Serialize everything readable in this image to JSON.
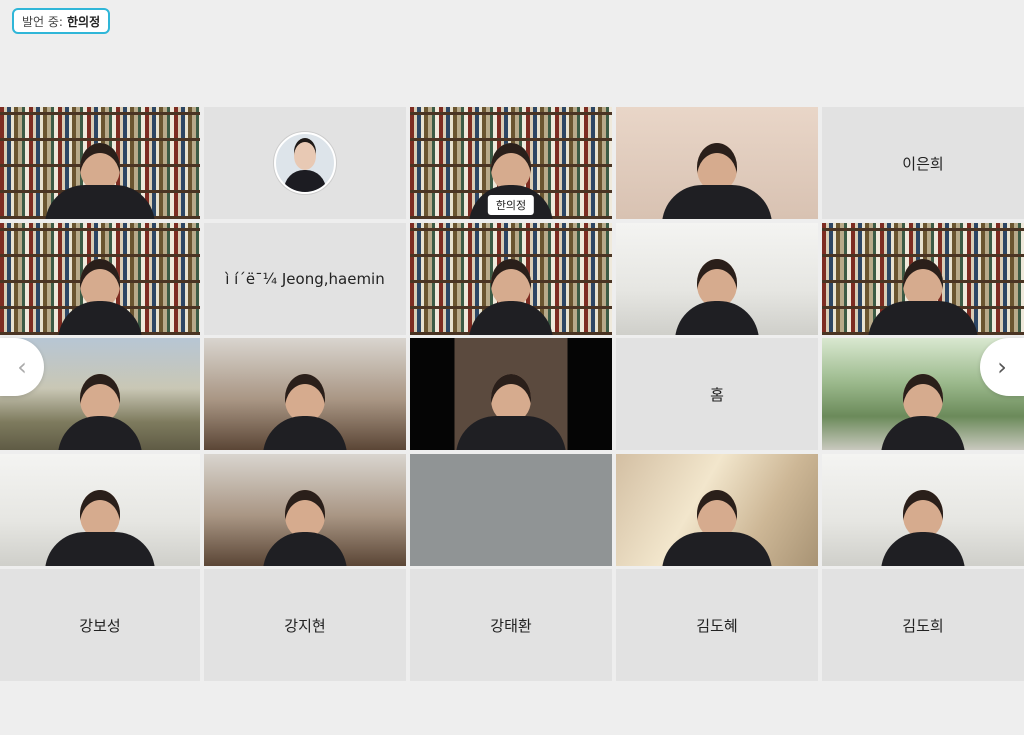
{
  "speaker": {
    "label": "발언 중:",
    "name": "한의정"
  },
  "tiles": [
    {
      "name": "",
      "kind": "video",
      "scene": "shelf"
    },
    {
      "name": "",
      "kind": "avatar"
    },
    {
      "name": "한의정",
      "kind": "video",
      "scene": "shelf",
      "active": true
    },
    {
      "name": "",
      "kind": "video",
      "scene": "wall"
    },
    {
      "name": "이은희",
      "kind": "name"
    },
    {
      "name": "",
      "kind": "video",
      "scene": "shelf"
    },
    {
      "name": "ì í´ë¯¼ Jeong,haemin",
      "kind": "name"
    },
    {
      "name": "",
      "kind": "video",
      "scene": "shelf"
    },
    {
      "name": "",
      "kind": "video",
      "scene": "room"
    },
    {
      "name": "",
      "kind": "video",
      "scene": "shelf"
    },
    {
      "name": "",
      "kind": "video",
      "scene": "landscape"
    },
    {
      "name": "",
      "kind": "video",
      "scene": "office"
    },
    {
      "name": "",
      "kind": "video",
      "scene": "dark"
    },
    {
      "name": "홈",
      "kind": "name"
    },
    {
      "name": "",
      "kind": "video",
      "scene": "forest"
    },
    {
      "name": "",
      "kind": "video",
      "scene": "room"
    },
    {
      "name": "",
      "kind": "video",
      "scene": "office"
    },
    {
      "name": "",
      "kind": "video",
      "scene": "blank"
    },
    {
      "name": "",
      "kind": "video",
      "scene": "warm"
    },
    {
      "name": "",
      "kind": "video",
      "scene": "room"
    },
    {
      "name": "강보성",
      "kind": "name"
    },
    {
      "name": "강지현",
      "kind": "name"
    },
    {
      "name": "강태환",
      "kind": "name"
    },
    {
      "name": "김도혜",
      "kind": "name"
    },
    {
      "name": "김도희",
      "kind": "name"
    }
  ],
  "nav": {
    "prev_icon": "chevron-left-icon",
    "next_icon": "chevron-right-icon",
    "prev_glyph": "‹",
    "next_glyph": "›"
  },
  "colors": {
    "accent": "#2fb6d8",
    "background": "#eeeeee",
    "tile": "#e2e2e2"
  }
}
